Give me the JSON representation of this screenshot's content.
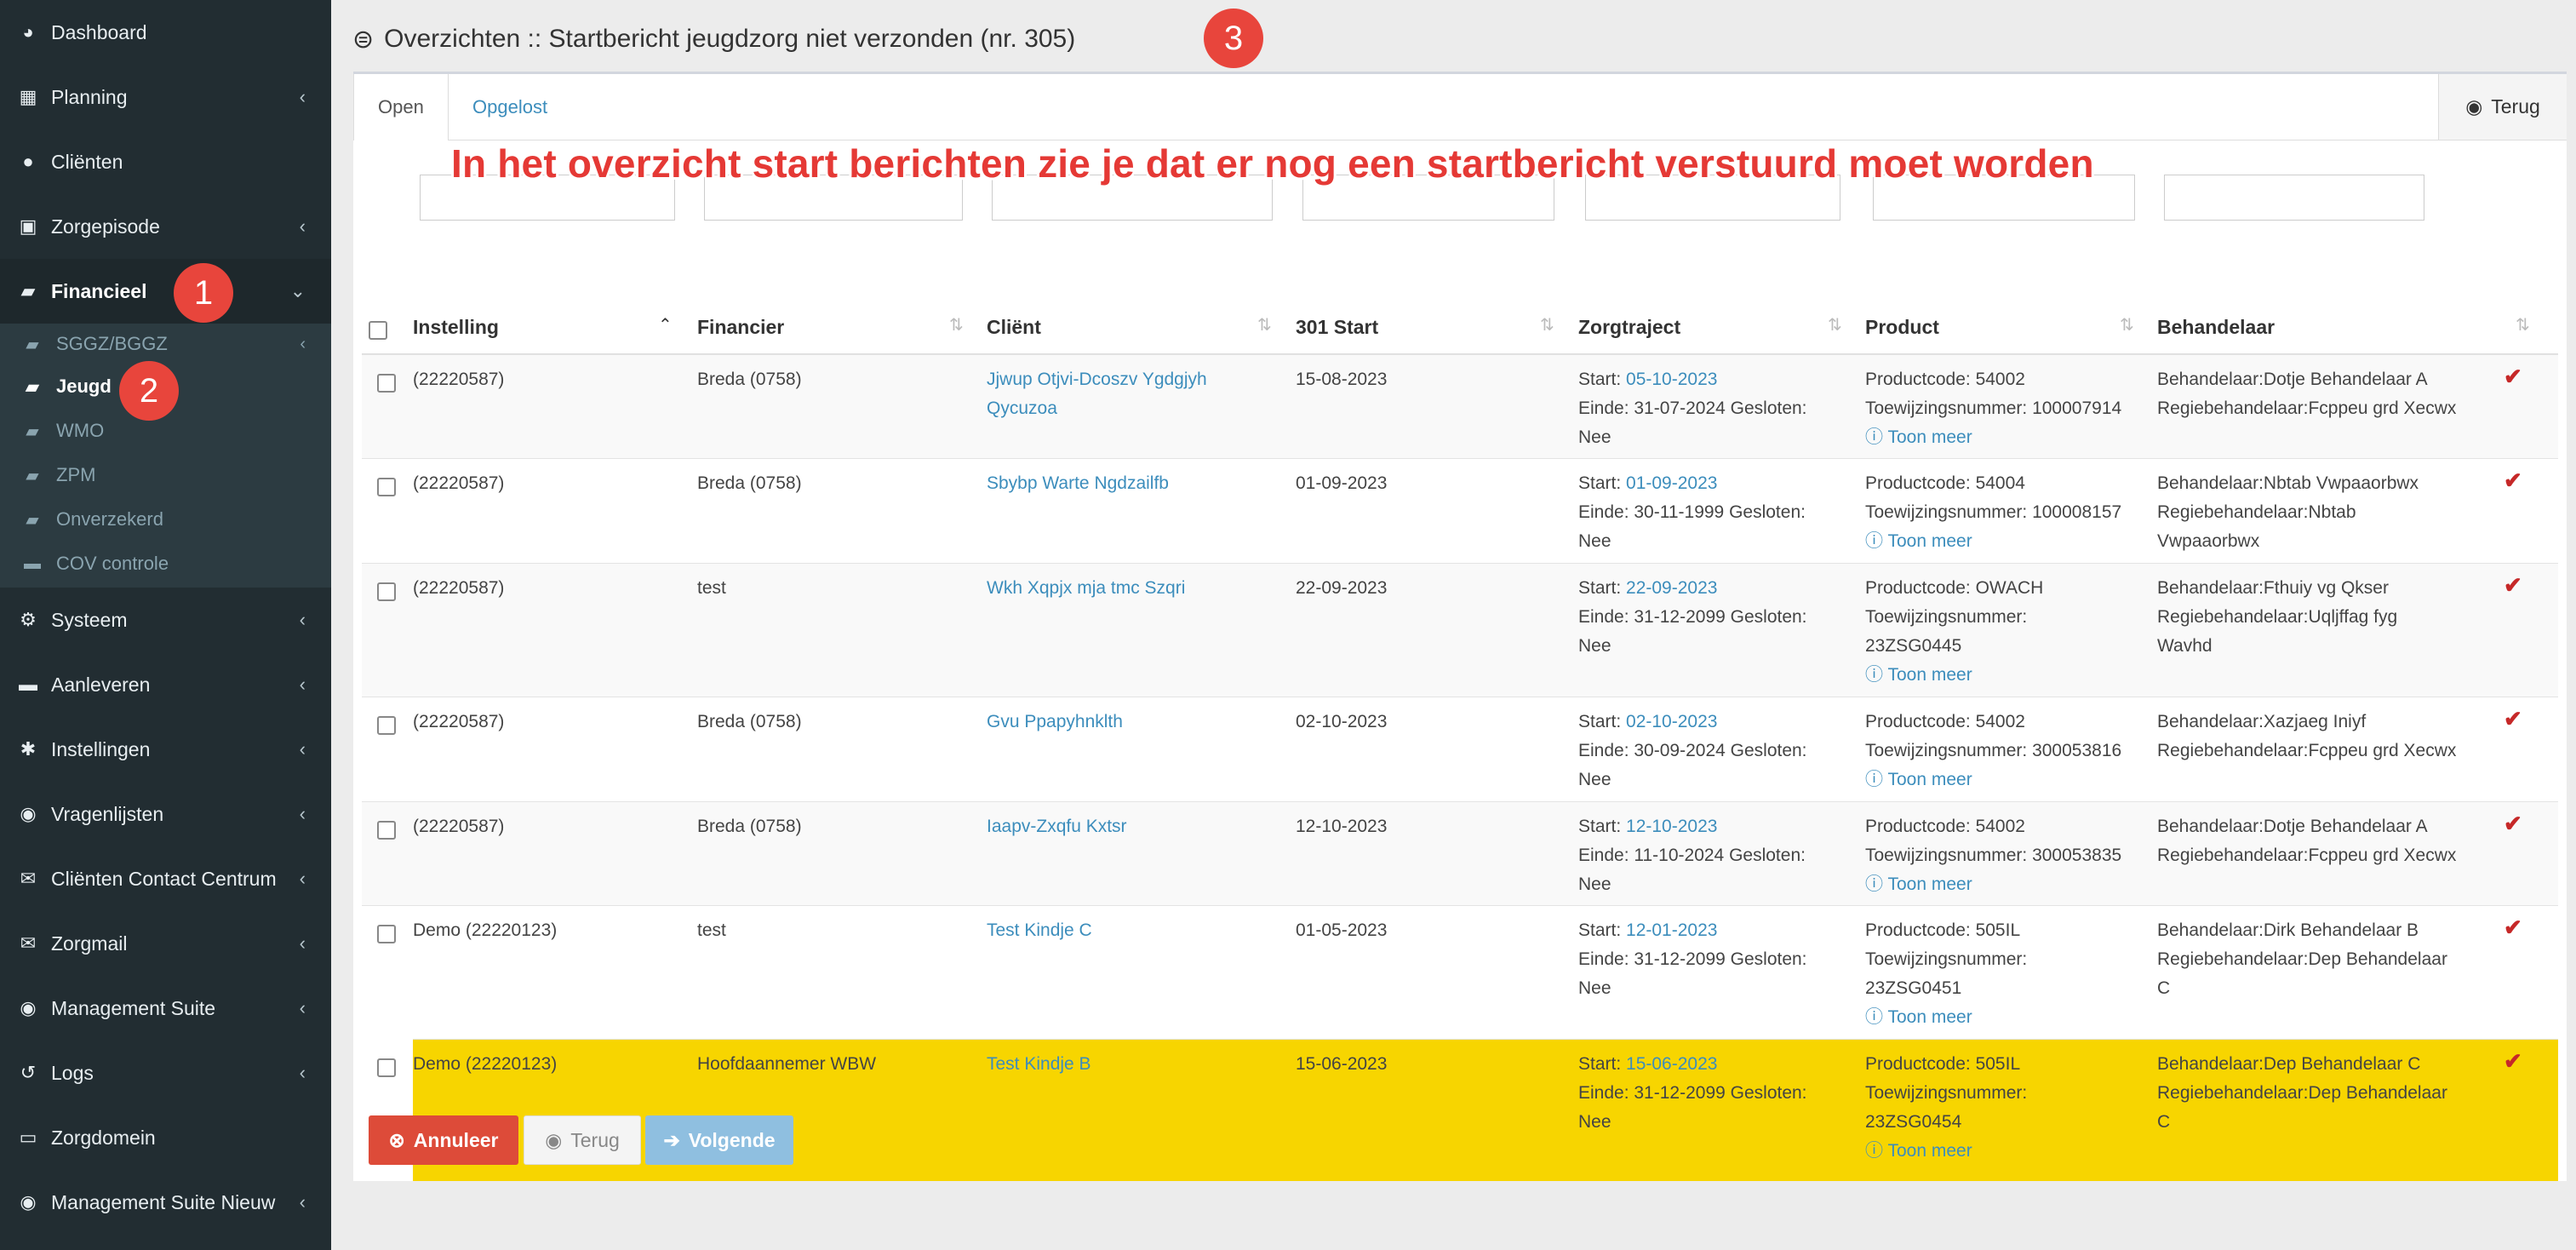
{
  "sidebar": {
    "items": [
      {
        "label": "Dashboard",
        "icon": "dashboard-icon",
        "glyph": "◕",
        "chevron": ""
      },
      {
        "label": "Planning",
        "icon": "calendar-icon",
        "glyph": "▦",
        "chevron": "‹"
      },
      {
        "label": "Cliënten",
        "icon": "user-icon",
        "glyph": "●",
        "chevron": ""
      },
      {
        "label": "Zorgepisode",
        "icon": "briefcase-icon",
        "glyph": "▣",
        "chevron": "‹"
      },
      {
        "label": "Financieel",
        "icon": "book-icon",
        "glyph": "▰",
        "chevron": "⌄"
      },
      {
        "label": "Systeem",
        "icon": "cogs-icon",
        "glyph": "⚙",
        "chevron": "‹"
      },
      {
        "label": "Aanleveren",
        "icon": "truck-icon",
        "glyph": "▬",
        "chevron": "‹"
      },
      {
        "label": "Instellingen",
        "icon": "gear-icon",
        "glyph": "✱",
        "chevron": "‹"
      },
      {
        "label": "Vragenlijsten",
        "icon": "globe-icon",
        "glyph": "◉",
        "chevron": "‹"
      },
      {
        "label": "Cliënten Contact Centrum",
        "icon": "envelope-icon",
        "glyph": "✉",
        "chevron": "‹"
      },
      {
        "label": "Zorgmail",
        "icon": "envelope-icon",
        "glyph": "✉",
        "chevron": "‹"
      },
      {
        "label": "Management Suite",
        "icon": "globe-icon",
        "glyph": "◉",
        "chevron": "‹"
      },
      {
        "label": "Logs",
        "icon": "history-icon",
        "glyph": "↺",
        "chevron": "‹"
      },
      {
        "label": "Zorgdomein",
        "icon": "hdd-icon",
        "glyph": "▭",
        "chevron": ""
      },
      {
        "label": "Management Suite Nieuw",
        "icon": "globe-icon",
        "glyph": "◉",
        "chevron": "‹"
      }
    ],
    "submenu": [
      {
        "label": "SGGZ/BGGZ",
        "chevron": "‹"
      },
      {
        "label": "Jeugd",
        "chevron": ""
      },
      {
        "label": "WMO",
        "chevron": ""
      },
      {
        "label": "ZPM",
        "chevron": ""
      },
      {
        "label": "Onverzekerd",
        "chevron": ""
      },
      {
        "label": "COV controle",
        "chevron": ""
      }
    ]
  },
  "badges": [
    "1",
    "2",
    "3"
  ],
  "header": {
    "title": "Overzichten :: Startbericht jeugdzorg niet verzonden (nr. 305)"
  },
  "tabs": {
    "open": "Open",
    "solved": "Opgelost",
    "back": "Terug"
  },
  "annotation": "In het overzicht start berichten zie je dat er nog een startbericht verstuurd moet worden",
  "table": {
    "columns": [
      "Instelling",
      "Financier",
      "Cliënt",
      "301 Start",
      "Zorgtraject",
      "Product",
      "Behandelaar"
    ],
    "rows": [
      {
        "instelling": "(22220587)",
        "financier": "Breda (0758)",
        "client_1": "Jjwup Otjvi-Dcoszv Ygdgjyh",
        "client_2": "Qycuzoa",
        "start": "15-08-2023",
        "zt_start_label": "Start:",
        "zt_start": "05-10-2023",
        "zt_line2": "Einde: 31-07-2024 Gesloten:",
        "zt_line3": "Nee",
        "p1": "Productcode: 54002",
        "p2": "Toewijzingsnummer: 100007914",
        "p3": "",
        "toon": "Toon meer",
        "b1": "Behandelaar:Dotje Behandelaar A",
        "b2": "Regiebehandelaar:Fcppeu grd Xecwx",
        "b3": ""
      },
      {
        "instelling": "(22220587)",
        "financier": "Breda (0758)",
        "client_1": "Sbybp Warte Ngdzailfb",
        "client_2": "",
        "start": "01-09-2023",
        "zt_start_label": "Start:",
        "zt_start": "01-09-2023",
        "zt_line2": "Einde: 30-11-1999 Gesloten:",
        "zt_line3": "Nee",
        "p1": "Productcode: 54004",
        "p2": "Toewijzingsnummer: 100008157",
        "p3": "",
        "toon": "Toon meer",
        "b1": "Behandelaar:Nbtab Vwpaaorbwx",
        "b2": "Regiebehandelaar:Nbtab",
        "b3": "Vwpaaorbwx"
      },
      {
        "instelling": "(22220587)",
        "financier": "test",
        "client_1": "Wkh Xqpjx mja tmc Szqri",
        "client_2": "",
        "start": "22-09-2023",
        "zt_start_label": "Start:",
        "zt_start": "22-09-2023",
        "zt_line2": "Einde: 31-12-2099 Gesloten:",
        "zt_line3": "Nee",
        "p1": "Productcode: OWACH",
        "p2": "Toewijzingsnummer:",
        "p3": "23ZSG0445",
        "toon": "Toon meer",
        "b1": "Behandelaar:Fthuiy vg Qkser",
        "b2": "Regiebehandelaar:Uqljffag fyg",
        "b3": "Wavhd"
      },
      {
        "instelling": "(22220587)",
        "financier": "Breda (0758)",
        "client_1": "Gvu Ppapyhnklth",
        "client_2": "",
        "start": "02-10-2023",
        "zt_start_label": "Start:",
        "zt_start": "02-10-2023",
        "zt_line2": "Einde: 30-09-2024 Gesloten:",
        "zt_line3": "Nee",
        "p1": "Productcode: 54002",
        "p2": "Toewijzingsnummer: 300053816",
        "p3": "",
        "toon": "Toon meer",
        "b1": "Behandelaar:Xazjaeg Iniyf",
        "b2": "Regiebehandelaar:Fcppeu grd Xecwx",
        "b3": ""
      },
      {
        "instelling": "(22220587)",
        "financier": "Breda (0758)",
        "client_1": "Iaapv-Zxqfu Kxtsr",
        "client_2": "",
        "start": "12-10-2023",
        "zt_start_label": "Start:",
        "zt_start": "12-10-2023",
        "zt_line2": "Einde: 11-10-2024 Gesloten:",
        "zt_line3": "Nee",
        "p1": "Productcode: 54002",
        "p2": "Toewijzingsnummer: 300053835",
        "p3": "",
        "toon": "Toon meer",
        "b1": "Behandelaar:Dotje Behandelaar A",
        "b2": "Regiebehandelaar:Fcppeu grd Xecwx",
        "b3": ""
      },
      {
        "instelling": "Demo (22220123)",
        "financier": "test",
        "client_1": "Test Kindje C",
        "client_2": "",
        "start": "01-05-2023",
        "zt_start_label": "Start:",
        "zt_start": "12-01-2023",
        "zt_line2": "Einde: 31-12-2099 Gesloten:",
        "zt_line3": "Nee",
        "p1": "Productcode: 505IL",
        "p2": "Toewijzingsnummer:",
        "p3": "23ZSG0451",
        "toon": "Toon meer",
        "b1": "Behandelaar:Dirk Behandelaar B",
        "b2": "Regiebehandelaar:Dep Behandelaar",
        "b3": "C"
      },
      {
        "instelling": "Demo (22220123)",
        "financier": "Hoofdaannemer WBW",
        "client_1": "Test Kindje B",
        "client_2": "",
        "start": "15-06-2023",
        "zt_start_label": "Start:",
        "zt_start": "15-06-2023",
        "zt_line2": "Einde: 31-12-2099 Gesloten:",
        "zt_line3": "Nee",
        "p1": "Productcode: 505IL",
        "p2": "Toewijzingsnummer:",
        "p3": "23ZSG0454",
        "toon": "Toon meer",
        "b1": "Behandelaar:Dep Behandelaar C",
        "b2": "Regiebehandelaar:Dep Behandelaar",
        "b3": "C"
      }
    ]
  },
  "buttons": {
    "cancel": "Annuleer",
    "back": "Terug",
    "next": "Volgende"
  },
  "colors": {
    "sidebar": "#222d32",
    "accent": "#3c8dbc",
    "highlight": "#f7d500",
    "danger": "#dd4b39",
    "badge": "#e8453c"
  }
}
